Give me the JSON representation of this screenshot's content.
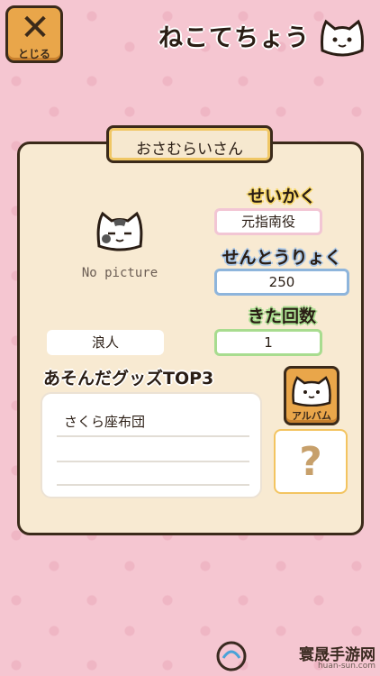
{
  "header": {
    "close_label": "とじる",
    "title": "ねこてちょう"
  },
  "cat": {
    "name": "おさむらいさん",
    "no_picture": "No picture",
    "personality_label": "せいかく",
    "personality_value": "元指南役",
    "power_label": "せんとうりょく",
    "power_value": "250",
    "visits_label": "きた回数",
    "visits_value": "1",
    "nickname_value": "浪人"
  },
  "goods": {
    "label": "あそんだグッズTOP3",
    "items": [
      "さくら座布団",
      "",
      ""
    ]
  },
  "side": {
    "album_label": "アルバム",
    "mystery_symbol": "?"
  },
  "footer": {
    "brand": "寰晟手游网",
    "url": "huan-sun.com"
  },
  "icons": {
    "close": "close-x-icon",
    "title_cat": "cat-face-icon",
    "album": "cat-face-icon",
    "mystery": "question-mark-icon"
  },
  "colors": {
    "background": "#f5c6d1",
    "card": "#f8ead2",
    "button": "#e9a64a",
    "outline": "#3b2a1a",
    "personality_accent": "#f7d86a",
    "power_accent": "#8eb5dc",
    "visits_accent": "#a8dc8f"
  }
}
